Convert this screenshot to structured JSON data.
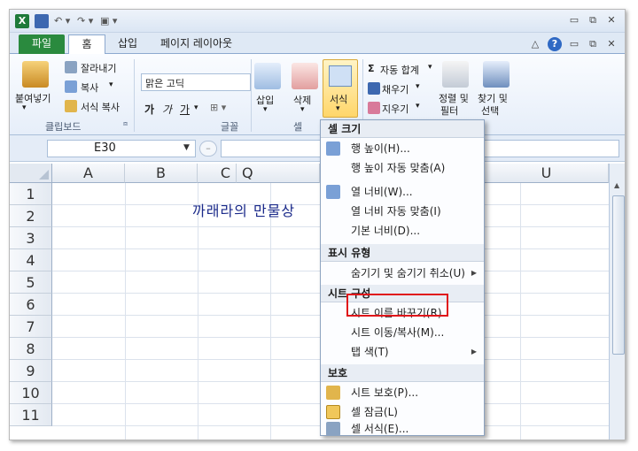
{
  "titlebar": {
    "excel_icon": "X",
    "qa_icons": [
      "excel-icon",
      "save-icon",
      "undo-icon",
      "redo-icon",
      "camera-icon"
    ]
  },
  "tabs": [
    {
      "label": "파일"
    },
    {
      "label": "홈"
    },
    {
      "label": "삽입"
    },
    {
      "label": "페이지 레이아웃"
    }
  ],
  "ribbon": {
    "paste": "붙여넣기",
    "cut": "잘라내기",
    "copy": "복사",
    "format_painter": "서식 복사",
    "clipboard_group": "클립보드",
    "font_name": "맑은 고딕",
    "font_buttons": [
      "가",
      "가",
      "가"
    ],
    "font_group": "글꼴",
    "insert": "삽입",
    "delete": "삭제",
    "format": "서식",
    "cells_group": "셀",
    "autosum": "자동 합계",
    "fill": "채우기",
    "clear": "지우기",
    "sort_filter_1": "정렬 및",
    "sort_filter_2": "필터",
    "find_select_1": "찾기 및",
    "find_select_2": "선택"
  },
  "formula_bar": {
    "name_box": "E30",
    "formula": ""
  },
  "columns": [
    "A",
    "B",
    "C",
    "Q",
    "U"
  ],
  "rows": [
    "1",
    "2",
    "3",
    "4",
    "5",
    "6",
    "7",
    "8",
    "9",
    "10",
    "11"
  ],
  "cell_text": "까래라의 만물상",
  "menu": {
    "sections": [
      {
        "header": "셀 크기"
      },
      {
        "header": "표시 유형"
      },
      {
        "header": "시트 구성"
      },
      {
        "header": "보호"
      }
    ],
    "items": [
      {
        "label": "행 높이(H)..."
      },
      {
        "label": "행 높이 자동 맞춤(A)"
      },
      {
        "label": "열 너비(W)..."
      },
      {
        "label": "열 너비 자동 맞춤(I)"
      },
      {
        "label": "기본 너비(D)..."
      },
      {
        "label": "숨기기 및 숨기기 취소(U)"
      },
      {
        "label": "시트 이름 바꾸기(R)"
      },
      {
        "label": "시트 이동/복사(M)..."
      },
      {
        "label": "탭 색(T)"
      },
      {
        "label": "시트 보호(P)..."
      },
      {
        "label": "셀 잠금(L)"
      },
      {
        "label": "셀 서식(E)..."
      }
    ]
  },
  "colors": {
    "file_tab": "#2a8a3e",
    "highlight": "#e0161a",
    "accent": "#2f69c4"
  }
}
